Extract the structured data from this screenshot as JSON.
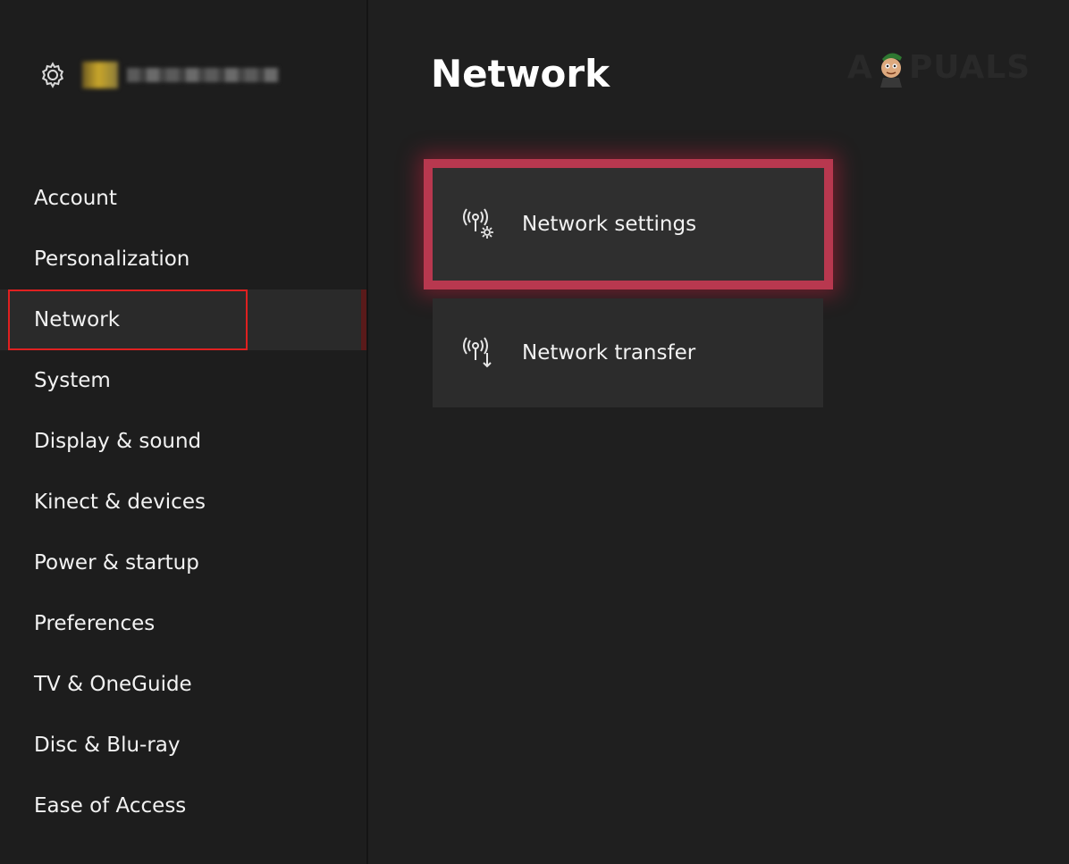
{
  "sidebar": {
    "items": [
      {
        "label": "Account"
      },
      {
        "label": "Personalization"
      },
      {
        "label": "Network"
      },
      {
        "label": "System"
      },
      {
        "label": "Display & sound"
      },
      {
        "label": "Kinect & devices"
      },
      {
        "label": "Power & startup"
      },
      {
        "label": "Preferences"
      },
      {
        "label": "TV & OneGuide"
      },
      {
        "label": "Disc & Blu-ray"
      },
      {
        "label": "Ease of Access"
      }
    ],
    "selected_index": 2
  },
  "main": {
    "title": "Network",
    "tiles": [
      {
        "label": "Network settings",
        "icon": "network-settings-icon",
        "focused": true
      },
      {
        "label": "Network transfer",
        "icon": "network-transfer-icon",
        "focused": false
      }
    ]
  },
  "watermark": {
    "text_left": "A",
    "text_right": "PUALS"
  },
  "colors": {
    "background": "#1f1f1f",
    "sidebar": "#1d1d1d",
    "tile": "#2c2c2c",
    "focus_border": "#b8384f",
    "annotation_red": "#e02020"
  }
}
